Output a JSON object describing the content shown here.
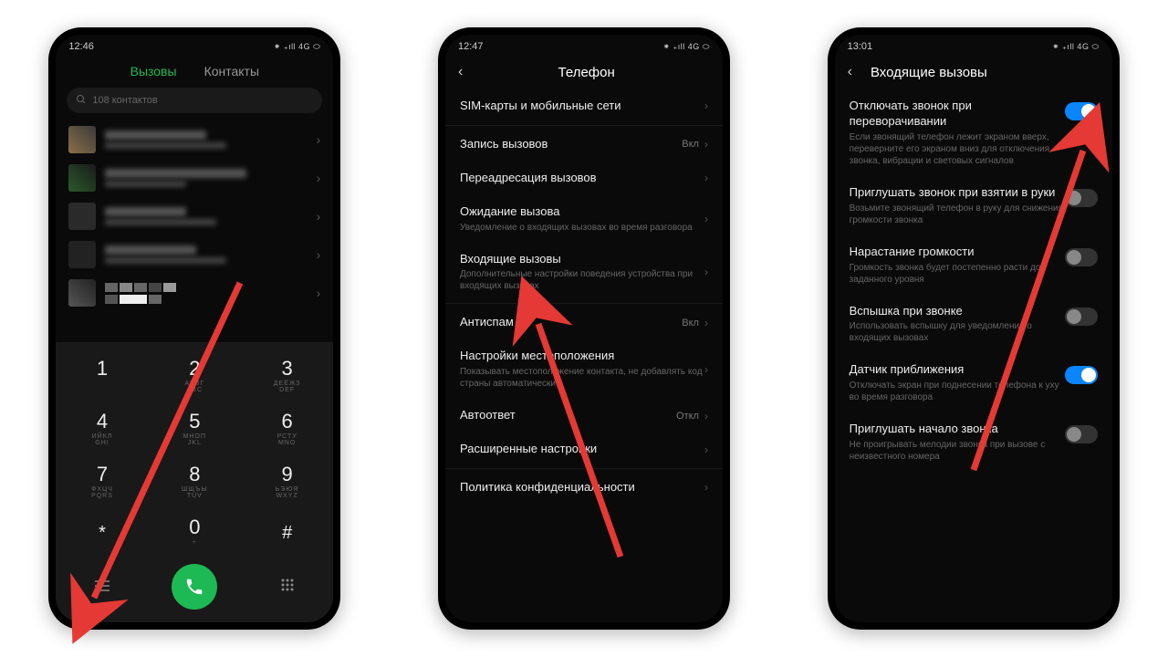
{
  "screen1": {
    "time": "12:46",
    "status": "⁕ ₊ıll 4G ⬭",
    "tab_calls": "Вызовы",
    "tab_contacts": "Контакты",
    "search_placeholder": "108 контактов",
    "dial": {
      "k1n": "1",
      "k1s": "",
      "k2n": "2",
      "k2s": "АБВГ\nABC",
      "k3n": "3",
      "k3s": "ДЕЁЖЗ\nDEF",
      "k4n": "4",
      "k4s": "ИЙКЛ\nGHI",
      "k5n": "5",
      "k5s": "МНОП\nJKL",
      "k6n": "6",
      "k6s": "РСТУ\nMNO",
      "k7n": "7",
      "k7s": "ФХЦЧ\nPQRS",
      "k8n": "8",
      "k8s": "ШЩЪЫ\nTUV",
      "k9n": "9",
      "k9s": "ЬЭЮЯ\nWXYZ",
      "kst": "*",
      "k0n": "0",
      "k0s": "+",
      "khs": "#"
    }
  },
  "screen2": {
    "time": "12:47",
    "status": "⁕ ₊ıll 4G ⬭",
    "title": "Телефон",
    "rows": [
      {
        "t": "SIM-карты и мобильные сети",
        "s": "",
        "v": ""
      },
      {
        "t": "Запись вызовов",
        "s": "",
        "v": "Вкл"
      },
      {
        "t": "Переадресация вызовов",
        "s": "",
        "v": ""
      },
      {
        "t": "Ожидание вызова",
        "s": "Уведомление о входящих вызовах во время разговора",
        "v": ""
      },
      {
        "t": "Входящие вызовы",
        "s": "Дополнительные настройки поведения устройства при входящих вызовах",
        "v": ""
      },
      {
        "t": "Антиспам",
        "s": "",
        "v": "Вкл"
      },
      {
        "t": "Настройки местоположения",
        "s": "Показывать местоположение контакта, не добавлять код страны автоматически",
        "v": ""
      },
      {
        "t": "Автоответ",
        "s": "",
        "v": "Откл"
      },
      {
        "t": "Расширенные настройки",
        "s": "",
        "v": ""
      },
      {
        "t": "Политика конфиденциальности",
        "s": "",
        "v": ""
      }
    ]
  },
  "screen3": {
    "time": "13:01",
    "status": "⁕ ₊ıll 4G ⬭",
    "title": "Входящие вызовы",
    "rows": [
      {
        "t": "Отключать звонок при переворачивании",
        "s": "Если звонящий телефон лежит экраном вверх, переверните его экраном вниз для отключения звонка, вибрации и световых сигналов",
        "on": true
      },
      {
        "t": "Приглушать звонок при взятии в руки",
        "s": "Возьмите звонящий телефон в руку для снижения громкости звонка",
        "on": false
      },
      {
        "t": "Нарастание громкости",
        "s": "Громкость звонка будет постепенно расти до заданного уровня",
        "on": false
      },
      {
        "t": "Вспышка при звонке",
        "s": "Использовать вспышку для уведомления о входящих вызовах",
        "on": false
      },
      {
        "t": "Датчик приближения",
        "s": "Отключать экран при поднесении телефона к уху во время разговора",
        "on": true
      },
      {
        "t": "Приглушать начало звонка",
        "s": "Не проигрывать мелодии звонка при вызове с неизвестного номера",
        "on": false
      }
    ]
  }
}
